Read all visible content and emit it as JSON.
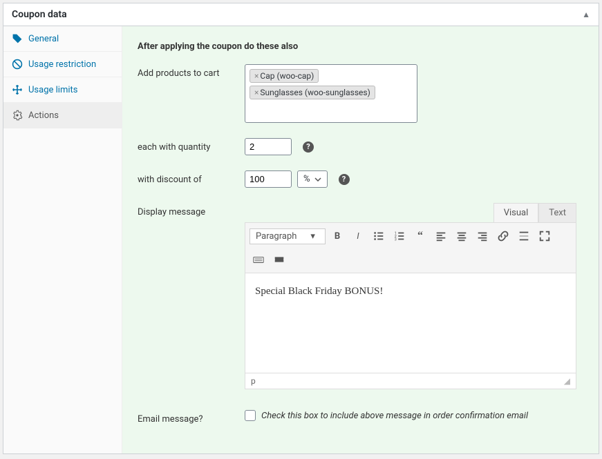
{
  "panel": {
    "title": "Coupon data"
  },
  "sidebar": {
    "items": [
      {
        "label": "General"
      },
      {
        "label": "Usage restriction"
      },
      {
        "label": "Usage limits"
      },
      {
        "label": "Actions"
      }
    ]
  },
  "form": {
    "heading": "After applying the coupon do these also",
    "add_products_label": "Add products to cart",
    "products": [
      "Cap (woo-cap)",
      "Sunglasses (woo-sunglasses)"
    ],
    "quantity_label": "each with quantity",
    "quantity_value": "2",
    "discount_label": "with discount of",
    "discount_value": "100",
    "discount_unit": "%",
    "display_message_label": "Display message",
    "email_label": "Email message?",
    "email_hint": "Check this box to include above message in order confirmation email"
  },
  "editor": {
    "tab_visual": "Visual",
    "tab_text": "Text",
    "format": "Paragraph",
    "content": "Special Black Friday BONUS!",
    "status": "p"
  }
}
